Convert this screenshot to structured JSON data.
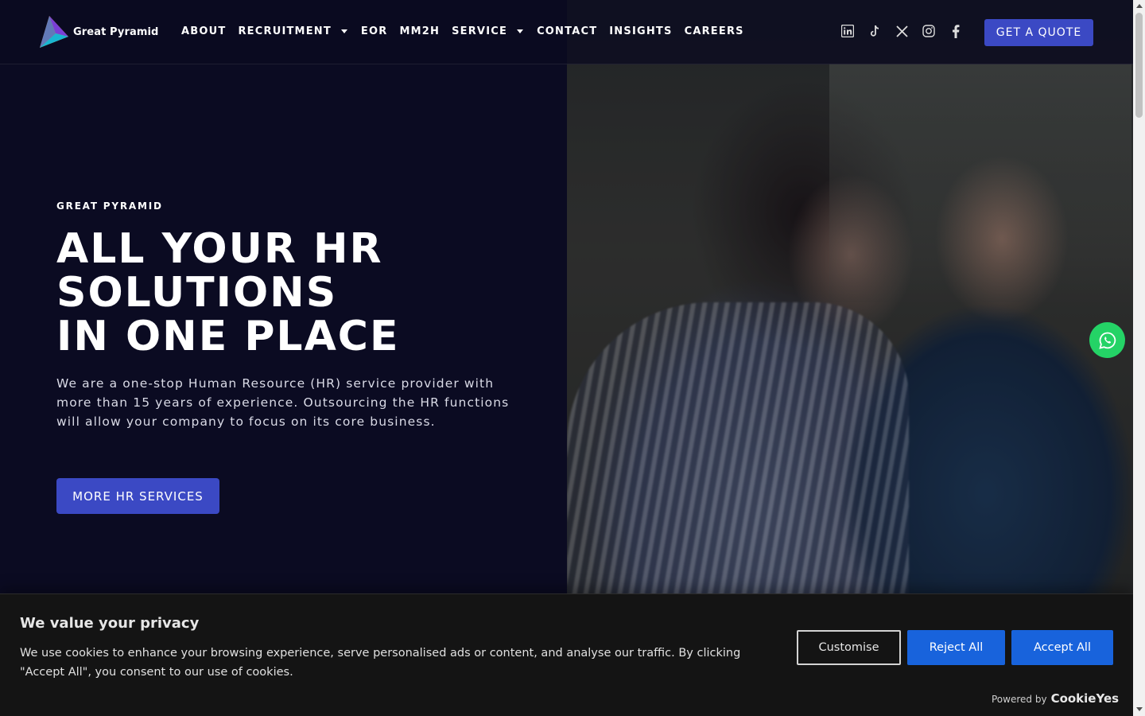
{
  "header": {
    "logo_text": "Great Pyramid",
    "nav": [
      {
        "label": "ABOUT",
        "dropdown": false
      },
      {
        "label": "RECRUITMENT",
        "dropdown": true
      },
      {
        "label": "EOR",
        "dropdown": false
      },
      {
        "label": "MM2H",
        "dropdown": false
      },
      {
        "label": "SERVICE",
        "dropdown": true
      },
      {
        "label": "CONTACT",
        "dropdown": false
      },
      {
        "label": "INSIGHTS",
        "dropdown": false
      },
      {
        "label": "CAREERS",
        "dropdown": false
      }
    ],
    "socials": [
      "linkedin-icon",
      "tiktok-icon",
      "x-icon",
      "instagram-icon",
      "facebook-icon"
    ],
    "quote_label": "GET A QUOTE"
  },
  "hero": {
    "eyebrow": "GREAT PYRAMID",
    "title_lines": [
      "ALL YOUR HR",
      "SOLUTIONS",
      "IN ONE PLACE"
    ],
    "description": "We are a one-stop Human Resource (HR) service provider with more than 15 years of experience. Outsourcing the HR functions will allow your company to focus on its core business.",
    "button_label": "MORE HR SERVICES"
  },
  "cookie": {
    "title": "We value your privacy",
    "text": "We use cookies to enhance your browsing experience, serve personalised ads or content, and analyse our traffic. By clicking \"Accept All\", you consent to our use of cookies.",
    "customise_label": "Customise",
    "reject_label": "Reject All",
    "accept_label": "Accept All",
    "powered_by": "Powered by",
    "powered_brand": "CookieYes"
  },
  "colors": {
    "accent": "#3b49c4",
    "background": "#0b0b22",
    "cookie_button": "#1863dc",
    "whatsapp": "#24d366"
  }
}
